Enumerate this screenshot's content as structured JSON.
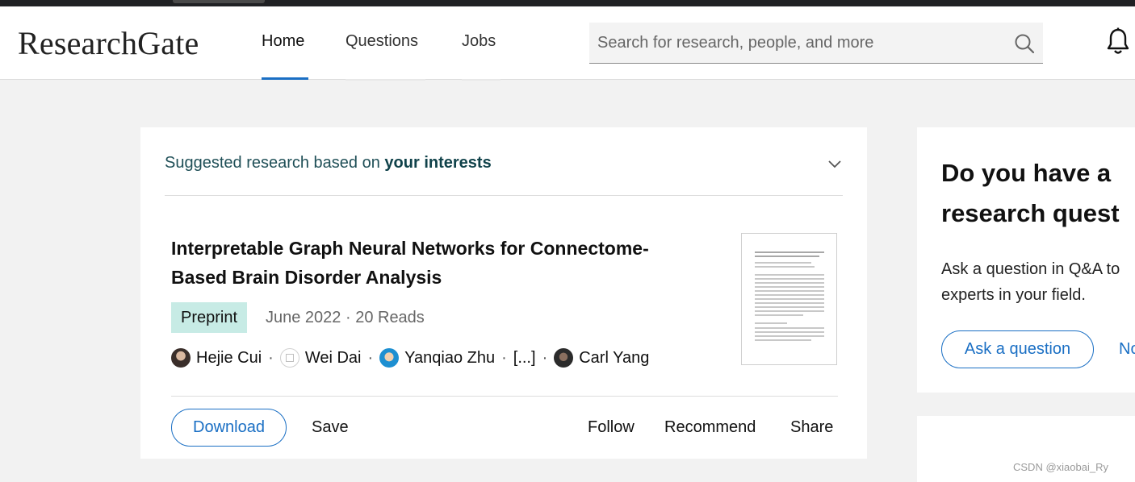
{
  "header": {
    "logo": "ResearchGate",
    "nav": [
      "Home",
      "Questions",
      "Jobs"
    ],
    "active_nav": "Home",
    "search_placeholder": "Search for research, people, and more"
  },
  "feed": {
    "suggest_prefix": "Suggested research based on ",
    "suggest_bold": "your interests",
    "publication": {
      "title": "Interpretable Graph Neural Networks for Connectome-Based Brain Disorder Analysis",
      "badge": "Preprint",
      "meta": "June 2022 · 20 Reads",
      "authors": [
        "Hejie Cui",
        "Wei Dai",
        "Yanqiao Zhu",
        "[...]",
        "Carl Yang"
      ],
      "separator": "·"
    },
    "actions": {
      "download": "Download",
      "save": "Save",
      "follow": "Follow",
      "recommend": "Recommend",
      "share": "Share"
    }
  },
  "sidebar": {
    "title_line1": "Do you have a",
    "title_line2": "research quest",
    "desc_line1": "Ask a question in Q&A to",
    "desc_line2": "experts in your field.",
    "ask_button": "Ask a question",
    "second_link": "No"
  },
  "watermark": "CSDN @xiaobai_Ry",
  "colors": {
    "accent": "#1a6fc4",
    "badge_bg": "#c7ebe5",
    "suggest_text": "#1f4f57"
  }
}
